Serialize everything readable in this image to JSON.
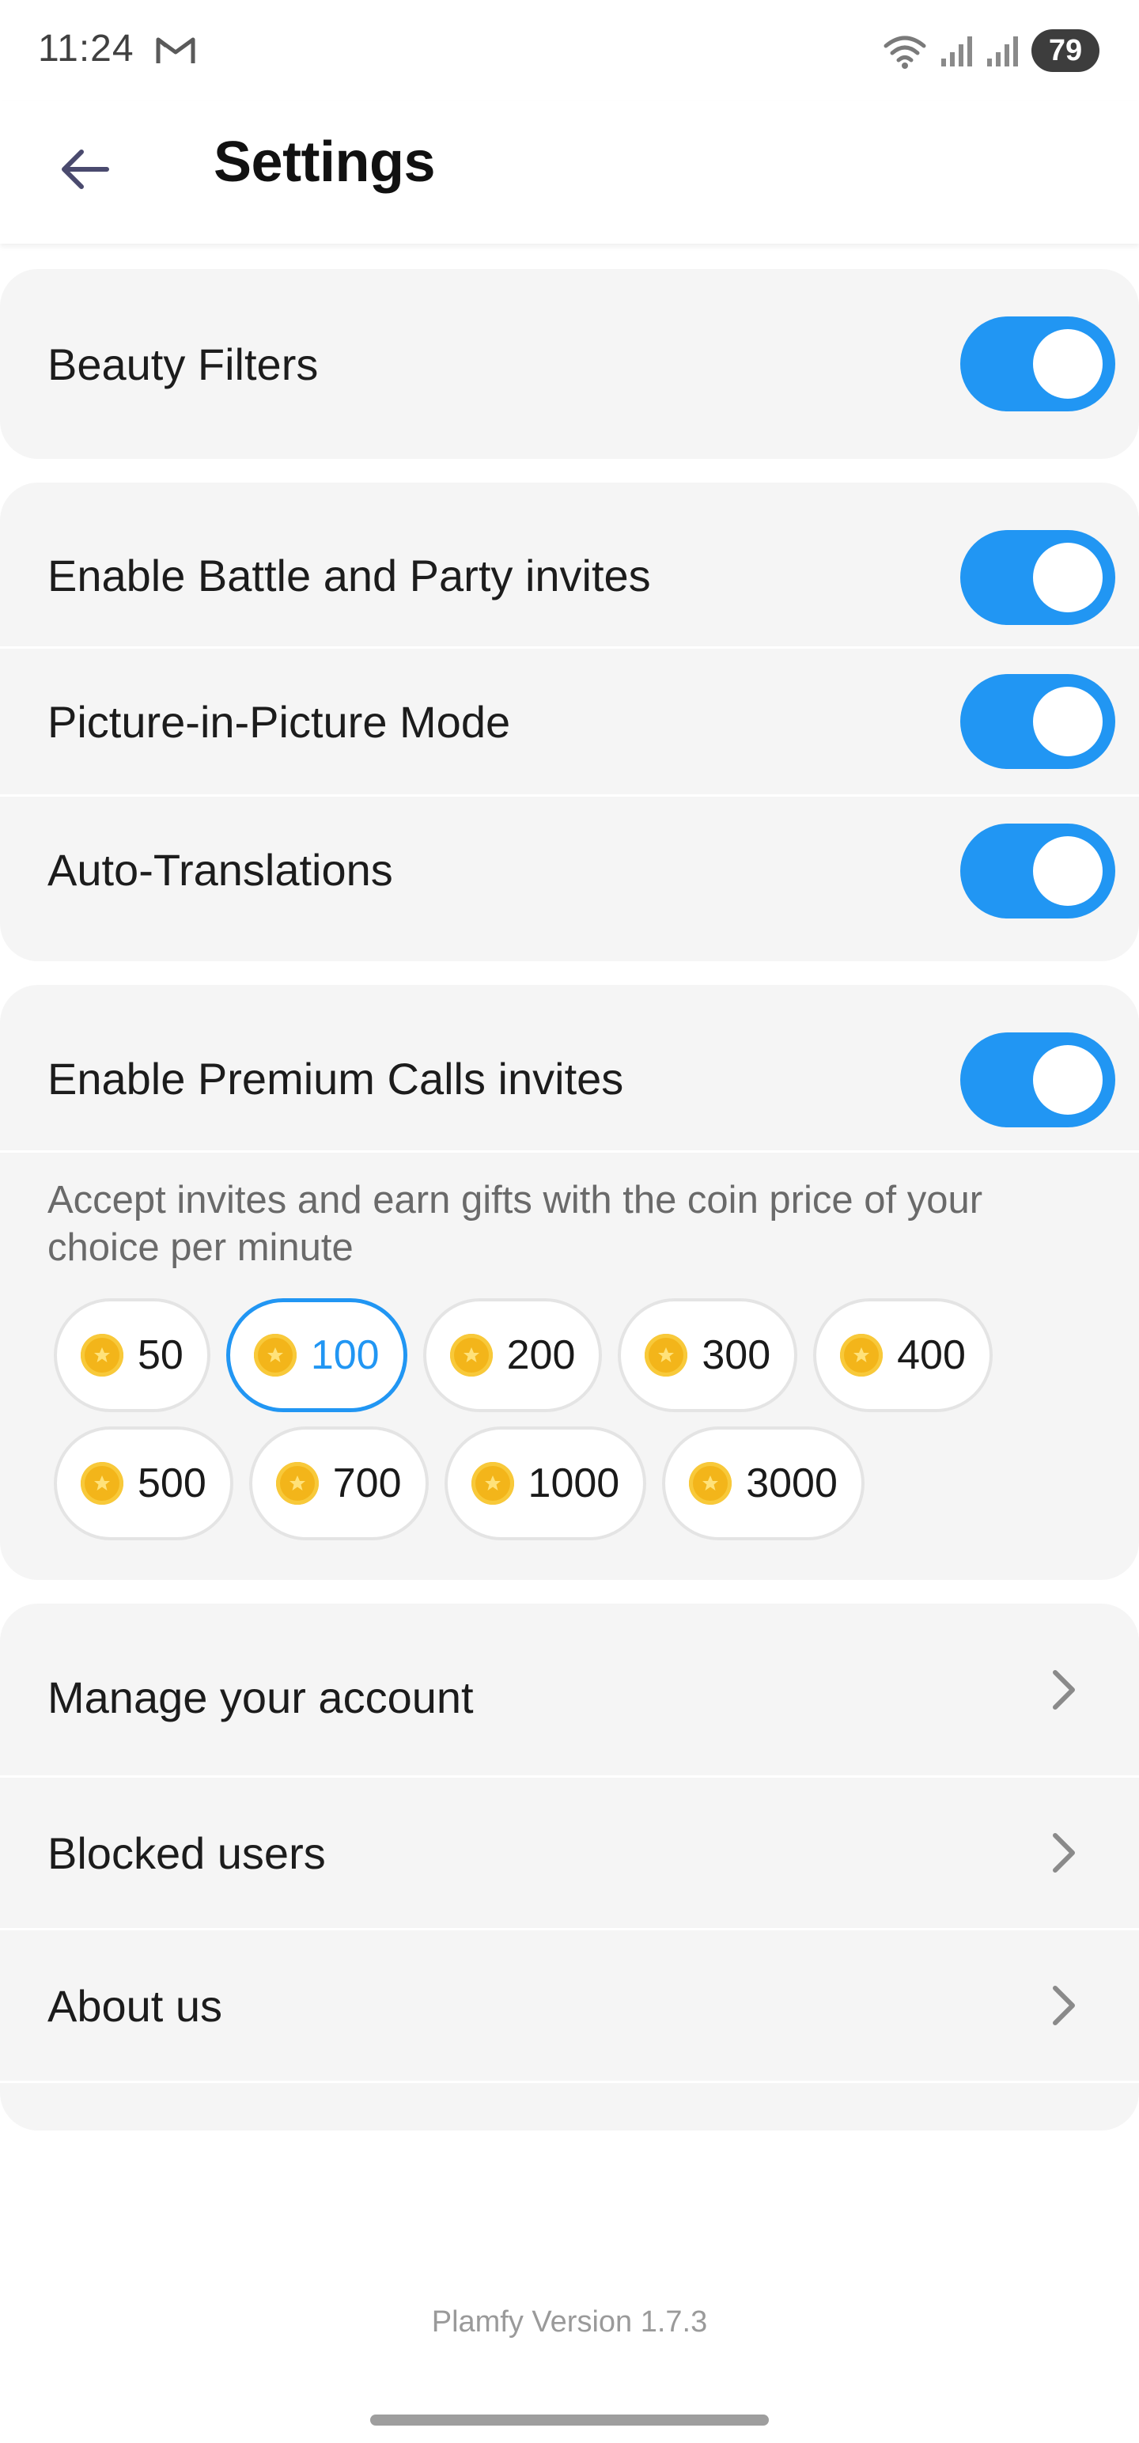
{
  "status_bar": {
    "time": "11:24",
    "battery": "79",
    "icons": [
      "gmail-icon",
      "wifi-icon",
      "signal-icon",
      "signal-icon",
      "battery-icon"
    ]
  },
  "header": {
    "title": "Settings",
    "back_icon": "back-arrow-icon"
  },
  "sections": {
    "beauty_filters": {
      "label": "Beauty Filters",
      "enabled": true
    },
    "battle_party_invites": {
      "label": "Enable Battle and Party invites",
      "enabled": true
    },
    "picture_in_picture": {
      "label": "Picture-in-Picture Mode",
      "enabled": true
    },
    "auto_translations": {
      "label": "Auto-Translations",
      "enabled": true
    },
    "premium_calls": {
      "label": "Enable Premium Calls invites",
      "enabled": true,
      "description": "Accept invites and earn gifts with the coin price of your choice per minute",
      "prices": [
        "50",
        "100",
        "200",
        "300",
        "400",
        "500",
        "700",
        "1000",
        "3000"
      ],
      "selected_price": "100"
    },
    "manage_account": {
      "label": "Manage your account"
    },
    "blocked_users": {
      "label": "Blocked users"
    },
    "about_us": {
      "label": "About us"
    }
  },
  "footer": {
    "version": "Plamfy Version 1.7.3"
  },
  "colors": {
    "accent": "#2196f3",
    "card_background": "#f5f5f5",
    "coin": "#f3b51a"
  }
}
